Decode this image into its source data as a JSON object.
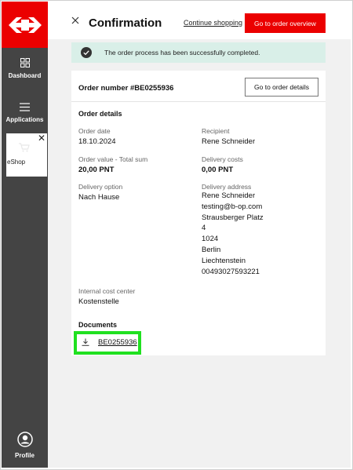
{
  "sidebar": {
    "items": [
      {
        "label": "Dashboard",
        "icon": "dashboard-icon"
      },
      {
        "label": "Applications",
        "icon": "menu-icon"
      }
    ],
    "eshop": {
      "label": "eShop",
      "icon": "cart-icon",
      "close": "✕"
    },
    "profile": {
      "label": "Profile",
      "icon": "profile-icon"
    }
  },
  "colors": {
    "brand": "#eb0000",
    "sidebar": "#444444",
    "success_bg": "#d9efe8",
    "highlight": "#20e020"
  },
  "header": {
    "title": "Confirmation",
    "continue_label": "Continue shopping",
    "overview_label": "Go to order overview"
  },
  "banner": {
    "text": "The order process has been successfully completed."
  },
  "order": {
    "number_label": "Order number #BE0255936",
    "details_button": "Go to order details",
    "details_heading": "Order details",
    "fields": {
      "order_date_label": "Order date",
      "order_date": "18.10.2024",
      "recipient_label": "Recipient",
      "recipient": "Rene Schneider",
      "order_value_label": "Order value - Total sum",
      "order_value": "20,00 PNT",
      "delivery_costs_label": "Delivery costs",
      "delivery_costs": "0,00 PNT",
      "delivery_option_label": "Delivery option",
      "delivery_option": "Nach Hause",
      "delivery_address_label": "Delivery address",
      "address": [
        "Rene Schneider",
        "testing@b-op.com",
        "Strausberger Platz",
        "4",
        "1024",
        "Berlin",
        "Liechtenstein",
        "00493027593221"
      ],
      "cost_center_label": "Internal cost center",
      "cost_center": "Kostenstelle"
    },
    "documents_heading": "Documents",
    "document_link": "BE0255936"
  }
}
